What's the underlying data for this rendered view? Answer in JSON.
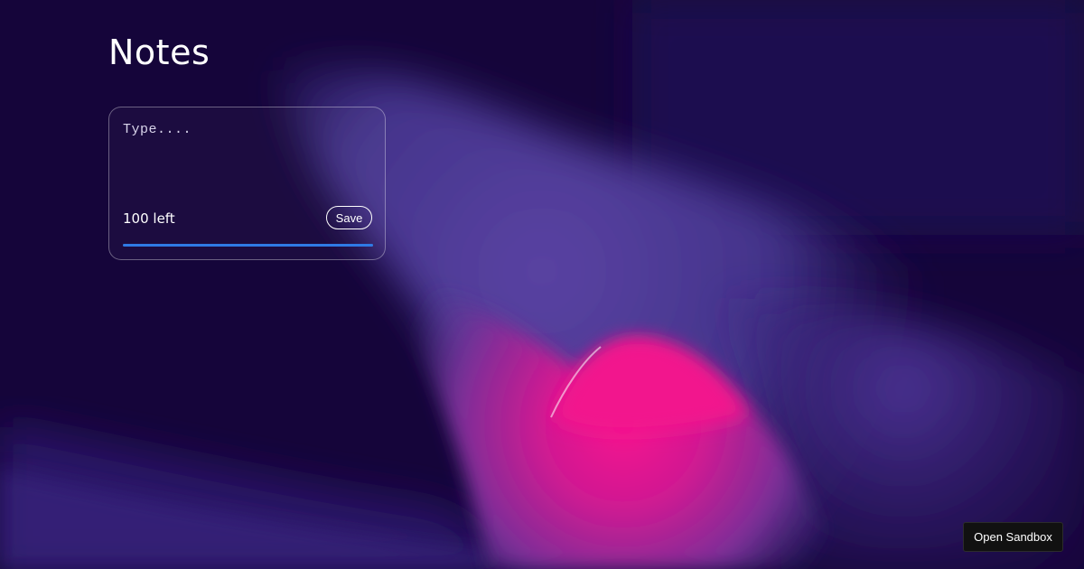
{
  "page": {
    "title": "Notes"
  },
  "note_card": {
    "placeholder": "Type....",
    "value": "",
    "remaining_label": "100 left",
    "save_label": "Save",
    "progress_fraction": 1.0
  },
  "sandbox_button": {
    "label": "Open Sandbox"
  },
  "colors": {
    "background": "#15053a",
    "accent_blue": "#2f7ae5",
    "wave_purple": "#4e3a92",
    "wave_pink": "#f0108f"
  }
}
